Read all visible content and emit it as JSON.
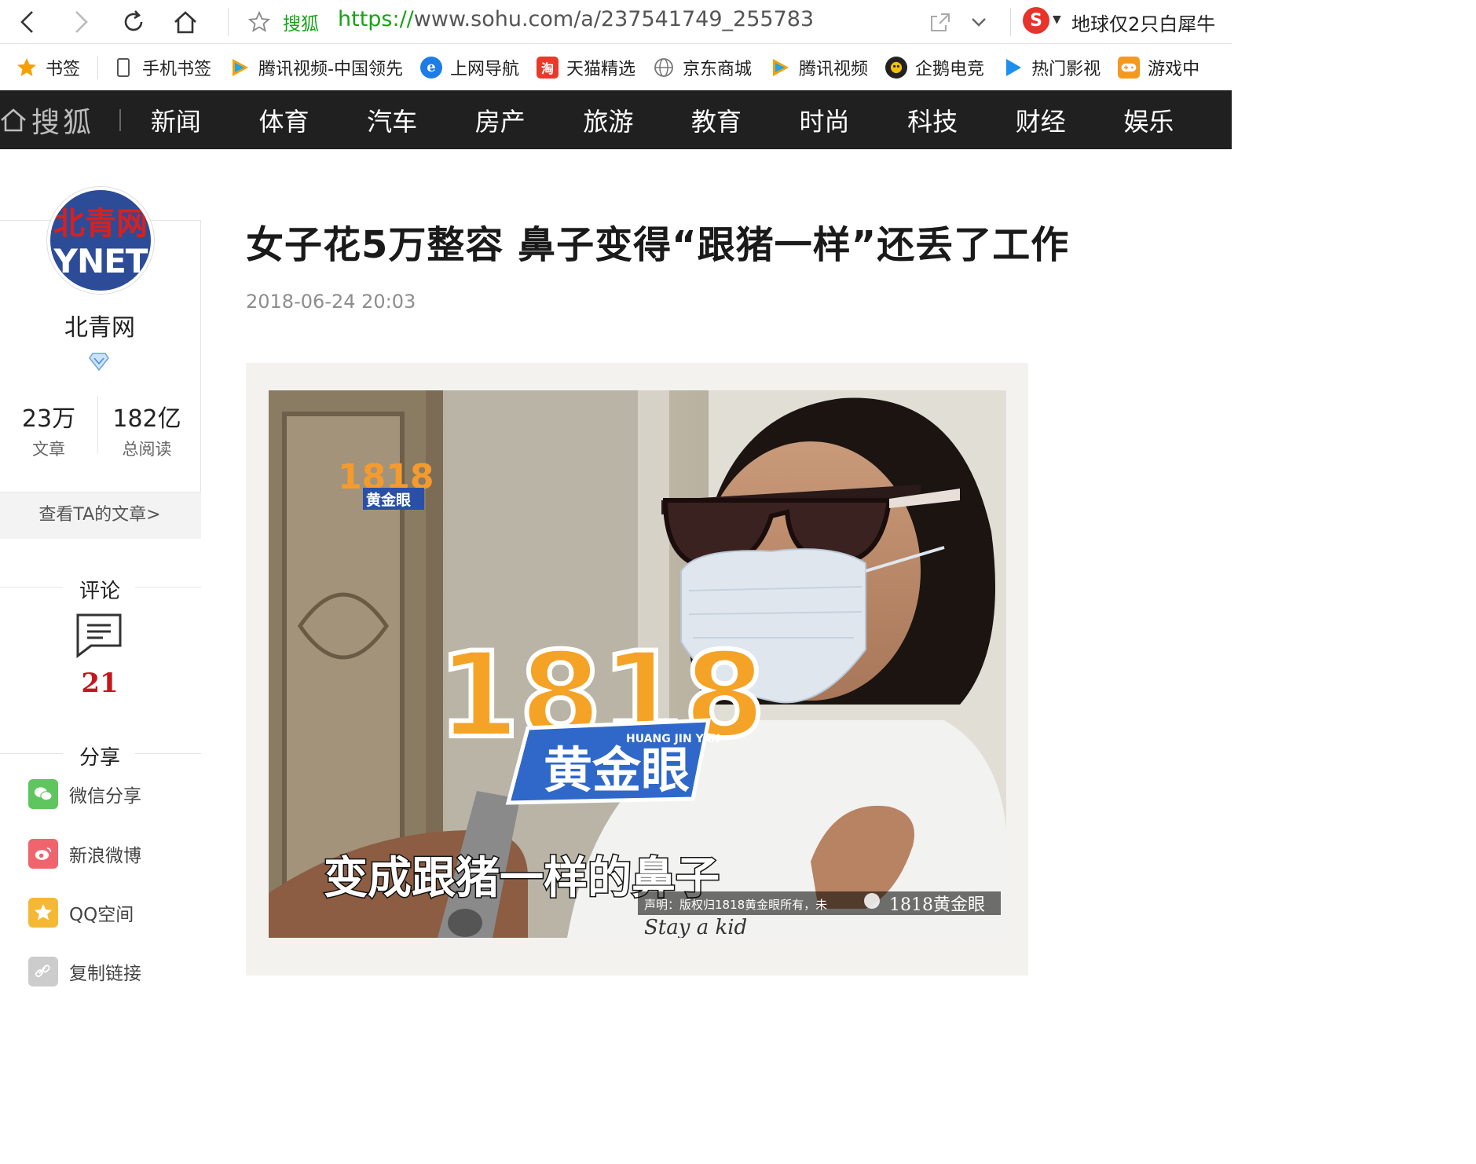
{
  "browser": {
    "site_name": "搜狐",
    "url_scheme": "https://",
    "url_rest": "www.sohu.com/a/237541749_255783",
    "search_engine_letter": "S",
    "search_hot": "地球仅2只白犀牛"
  },
  "bookmarks": [
    {
      "label": "书签",
      "icon": "star-icon",
      "color": "#f5a000"
    },
    {
      "label": "手机书签",
      "icon": "phone-icon",
      "color": "#555555"
    },
    {
      "label": "腾讯视频-中国领先",
      "icon": "tencent-video-icon",
      "color": "#20a6ef"
    },
    {
      "label": "上网导航",
      "icon": "ie-icon",
      "color": "#1e7ce6"
    },
    {
      "label": "天猫精选",
      "icon": "tmall-icon",
      "color": "#e8392a"
    },
    {
      "label": "京东商城",
      "icon": "globe-icon",
      "color": "#777777"
    },
    {
      "label": "腾讯视频",
      "icon": "tencent-video-icon",
      "color": "#20a6ef"
    },
    {
      "label": "企鹅电竞",
      "icon": "penguin-esports-icon",
      "color": "#222222"
    },
    {
      "label": "热门影视",
      "icon": "play-icon",
      "color": "#1e8fef"
    },
    {
      "label": "游戏中",
      "icon": "gamepad-icon",
      "color": "#f39a1e"
    }
  ],
  "sohu_nav": {
    "logo": "搜狐",
    "items": [
      "新闻",
      "体育",
      "汽车",
      "房产",
      "旅游",
      "教育",
      "时尚",
      "科技",
      "财经",
      "娱乐"
    ]
  },
  "author": {
    "logo_top": "北青网",
    "logo_bottom": "YNET",
    "name": "北青网",
    "articles_num": "23万",
    "articles_label": "文章",
    "reads_num": "182亿",
    "reads_label": "总阅读",
    "view_link": "查看TA的文章>"
  },
  "comments": {
    "heading": "评论",
    "count": "21"
  },
  "share": {
    "heading": "分享",
    "items": [
      {
        "label": "微信分享",
        "icon": "wechat-icon",
        "color": "#5fc55f"
      },
      {
        "label": "新浪微博",
        "icon": "weibo-icon",
        "color": "#f0646e"
      },
      {
        "label": "QQ空间",
        "icon": "qzone-icon",
        "color": "#f5b835"
      },
      {
        "label": "复制链接",
        "icon": "link-icon",
        "color": "#cccccc"
      }
    ]
  },
  "article": {
    "title": "女子花5万整容 鼻子变得“跟猪一样”还丢了工作",
    "time": "2018-06-24 20:03",
    "photo": {
      "station_logo_num": "1818",
      "station_logo_name": "黄金眼",
      "mic_logo_num": "1818",
      "mic_logo_name": "黄金眼",
      "mic_logo_pinyin": "HUANG JIN YAN",
      "subtitle": "变成跟猪一样的鼻子",
      "copyright_note": "声明：版权归1818黄金眼所有，未",
      "watermark": "1818黄金眼",
      "shirt_text": "Stay a kid"
    }
  }
}
